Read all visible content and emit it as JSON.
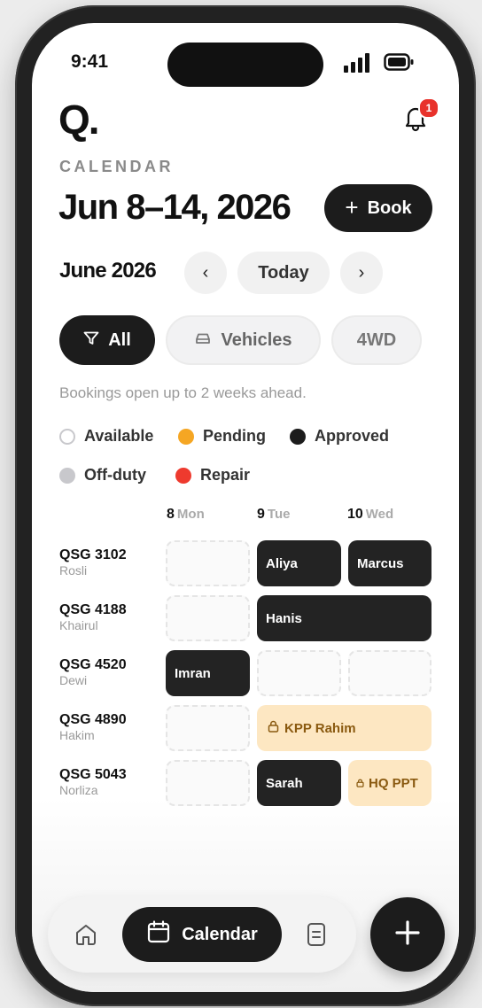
{
  "status_bar": {
    "time": "9:41"
  },
  "app": {
    "logo": "Q."
  },
  "notifications": {
    "badge_count": "1",
    "icon": "bell-icon"
  },
  "header": {
    "eyebrow": "CALENDAR",
    "title": "Jun 8–14, 2026",
    "book_label": "Book"
  },
  "nav": {
    "month": "June 2026",
    "prev_label": "‹",
    "today_label": "Today",
    "next_label": "›"
  },
  "filters": [
    {
      "label": "All",
      "icon": "filter-icon",
      "active": true
    },
    {
      "label": "Vehicles",
      "icon": "car-icon",
      "active": false
    },
    {
      "label": "4WD",
      "active": false
    }
  ],
  "hint": "Bookings open up to 2 weeks ahead.",
  "legend": [
    {
      "label": "Available",
      "color": "#ffffff"
    },
    {
      "label": "Pending",
      "color": "#f5a623"
    },
    {
      "label": "Approved",
      "color": "#1c1c1c"
    },
    {
      "label": "Off-duty",
      "color": "#c8c8cc"
    },
    {
      "label": "Repair",
      "color": "#ee3a2e"
    }
  ],
  "days": [
    {
      "num": "8",
      "name": "Mon"
    },
    {
      "num": "9",
      "name": "Tue"
    },
    {
      "num": "10",
      "name": "Wed"
    }
  ],
  "rows": [
    {
      "plate": "QSG 3102",
      "driver": "Rosli"
    },
    {
      "plate": "QSG 4188",
      "driver": "Khairul"
    },
    {
      "plate": "QSG 4520",
      "driver": "Dewi"
    },
    {
      "plate": "QSG 4890",
      "driver": "Hakim"
    },
    {
      "plate": "QSG 5043",
      "driver": "Norliza"
    }
  ],
  "bookings": {
    "r1_tue": "Aliya",
    "r1_wed": "Marcus",
    "r2_tue_wed": "Hanis",
    "r3_mon": "Imran",
    "r4_tue_wed": "KPP Rahim",
    "r5_tue": "Sarah",
    "r5_wed": "HQ PPT"
  },
  "tabbar": {
    "calendar_label": "Calendar"
  },
  "colors": {
    "dark": "#1c1c1c",
    "pending_bg": "#fde7c2",
    "pending_text": "#8a5a10",
    "badge": "#e8322b"
  }
}
